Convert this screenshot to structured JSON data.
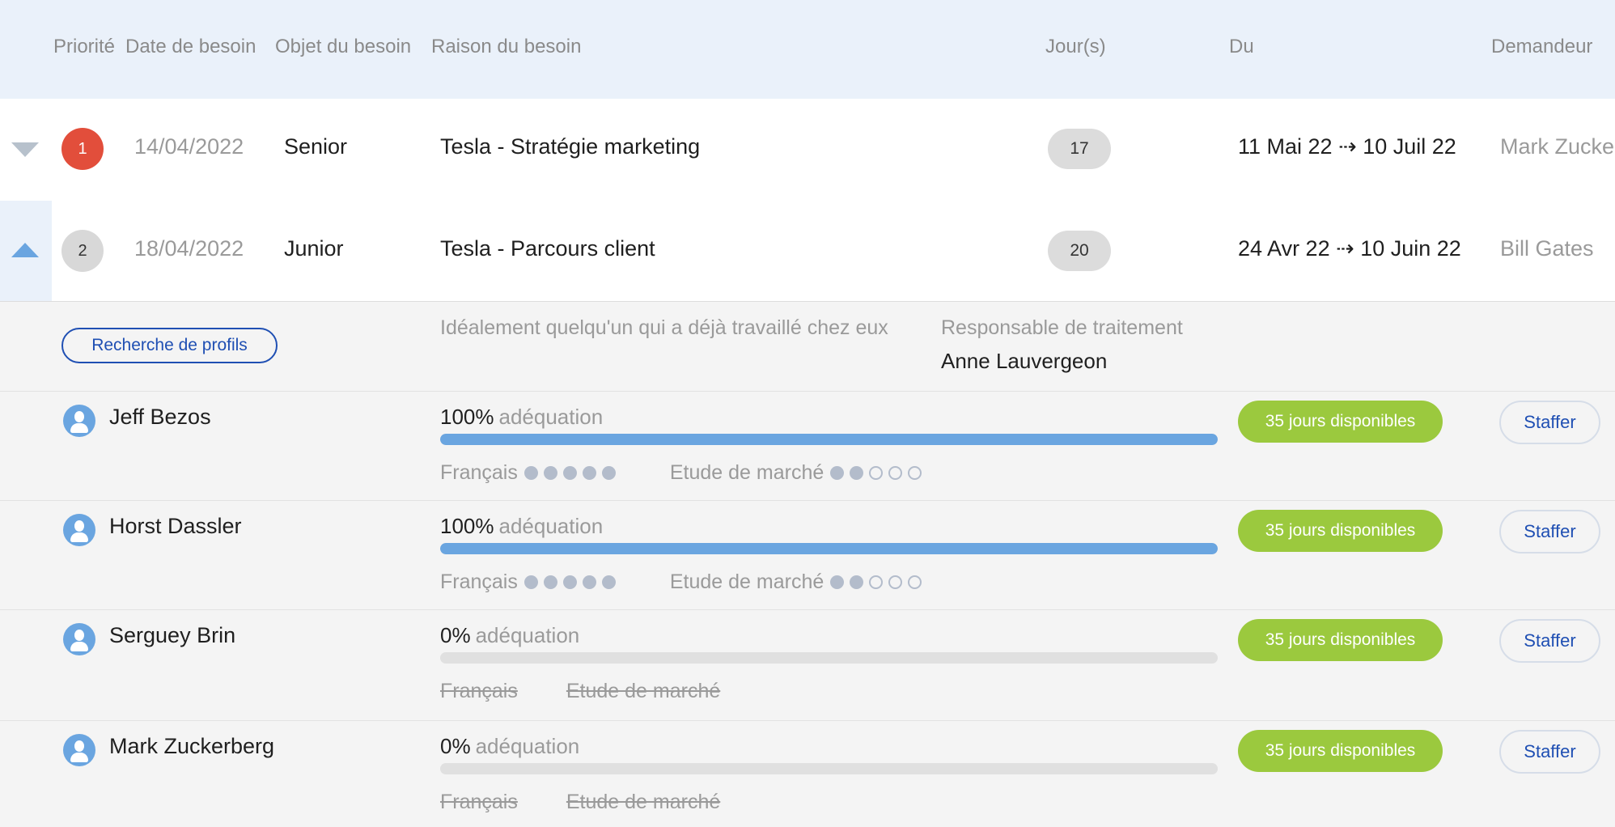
{
  "header": {
    "priority": "Priorité",
    "need_date": "Date de besoin",
    "need_object": "Objet du besoin",
    "need_reason": "Raison du besoin",
    "days": "Jour(s)",
    "from": "Du",
    "requester": "Demandeur"
  },
  "needs": [
    {
      "priority": "1",
      "date": "14/04/2022",
      "level": "Senior",
      "subject": "Tesla - Stratégie marketing",
      "days": "17",
      "period": "11 Mai 22 ⇢ 10 Juil 22",
      "requester": "Mark Zucke",
      "expanded": false
    },
    {
      "priority": "2",
      "date": "18/04/2022",
      "level": "Junior",
      "subject": "Tesla - Parcours client",
      "days": "20",
      "period": "24 Avr 22 ⇢ 10 Juin 22",
      "requester": "Bill Gates",
      "expanded": true
    }
  ],
  "detail": {
    "search_button": "Recherche de profils",
    "reason": "Idéalement quelqu'un qui a déjà travaillé chez eux",
    "owner_label": "Responsable de traitement",
    "owner_name": "Anne Lauvergeon"
  },
  "candidates": [
    {
      "name": "Jeff Bezos",
      "match_pct": "100%",
      "match_fraction": 1.0,
      "match_label": "adéquation",
      "skills": [
        {
          "label": "Français",
          "level": 5,
          "max": 5,
          "active": true
        },
        {
          "label": "Etude de marché",
          "level": 2,
          "max": 5,
          "active": true
        }
      ],
      "availability": "35 jours disponibles",
      "action": "Staffer"
    },
    {
      "name": "Horst Dassler",
      "match_pct": "100%",
      "match_fraction": 1.0,
      "match_label": "adéquation",
      "skills": [
        {
          "label": "Français",
          "level": 5,
          "max": 5,
          "active": true
        },
        {
          "label": "Etude de marché",
          "level": 2,
          "max": 5,
          "active": true
        }
      ],
      "availability": "35 jours disponibles",
      "action": "Staffer"
    },
    {
      "name": "Serguey Brin",
      "match_pct": "0%",
      "match_fraction": 0.0,
      "match_label": "adéquation",
      "skills": [
        {
          "label": "Français",
          "level": 0,
          "max": 5,
          "active": false
        },
        {
          "label": "Etude de marché",
          "level": 0,
          "max": 5,
          "active": false
        }
      ],
      "availability": "35 jours disponibles",
      "action": "Staffer"
    },
    {
      "name": "Mark Zuckerberg",
      "match_pct": "0%",
      "match_fraction": 0.0,
      "match_label": "adéquation",
      "skills": [
        {
          "label": "Français",
          "level": 0,
          "max": 5,
          "active": false
        },
        {
          "label": "Etude de marché",
          "level": 0,
          "max": 5,
          "active": false
        }
      ],
      "availability": "35 jours disponibles",
      "action": "Staffer"
    }
  ],
  "colors": {
    "header_bg": "#eaf1fa",
    "priority_high": "#e24e3b",
    "accent_blue": "#6aa5e0",
    "availability_green": "#9bc93e",
    "link_blue": "#1f4fb3"
  }
}
